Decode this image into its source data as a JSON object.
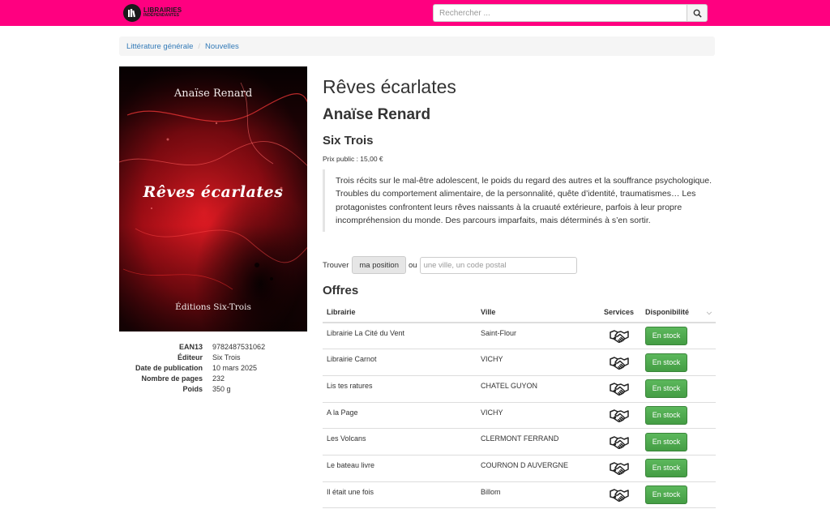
{
  "header": {
    "logo_line1": "LIBRAIRIES",
    "logo_line2": "INDÉPENDANTES",
    "search_placeholder": "Rechercher ...",
    "search_icon": "search-icon"
  },
  "breadcrumb": [
    {
      "label": "Littérature générale"
    },
    {
      "label": "Nouvelles"
    }
  ],
  "cover": {
    "author": "Anaïse Renard",
    "title": "Rêves écarlates",
    "publisher": "Éditions Six-Trois"
  },
  "meta": [
    {
      "label": "EAN13",
      "value": "9782487531062"
    },
    {
      "label": "Éditeur",
      "value": "Six Trois"
    },
    {
      "label": "Date de publication",
      "value": "10 mars 2025"
    },
    {
      "label": "Nombre de pages",
      "value": "232"
    },
    {
      "label": "Poids",
      "value": "350 g"
    }
  ],
  "book": {
    "title": "Rêves écarlates",
    "author": "Anaïse Renard",
    "publisher": "Six Trois",
    "price": "Prix public : 15,00 €",
    "description": "Trois récits sur le mal-être adolescent, le poids du regard des autres et la souffrance psychologique. Troubles du comportement alimentaire, de la personnalité, quête d’identité, traumatismes… Les protagonistes confrontent leurs rêves naissants à la cruauté extérieure, parfois à leur propre incompréhension du monde. Des parcours imparfaits, mais déterminés à s’en sortir."
  },
  "find": {
    "label": "Trouver",
    "button": "ma position",
    "or": "ou",
    "placeholder": "une ville, un code postal"
  },
  "offers": {
    "heading": "Offres",
    "columns": {
      "store": "Librairie",
      "city": "Ville",
      "services": "Services",
      "availability": "Disponibilité"
    },
    "rows": [
      {
        "store": "Librairie La Cité du Vent",
        "city": "Saint-Flour",
        "service_icon": "handshake-icon",
        "availability": "En stock"
      },
      {
        "store": "Librairie Carnot",
        "city": "VICHY",
        "service_icon": "handshake-icon",
        "availability": "En stock"
      },
      {
        "store": "Lis tes ratures",
        "city": "CHATEL GUYON",
        "service_icon": "handshake-icon",
        "availability": "En stock"
      },
      {
        "store": "A la Page",
        "city": "VICHY",
        "service_icon": "handshake-icon",
        "availability": "En stock"
      },
      {
        "store": "Les Volcans",
        "city": "CLERMONT FERRAND",
        "service_icon": "handshake-icon",
        "availability": "En stock"
      },
      {
        "store": "Le bateau livre",
        "city": "COURNON D AUVERGNE",
        "service_icon": "handshake-icon",
        "availability": "En stock"
      },
      {
        "store": "Il était une fois",
        "city": "Billom",
        "service_icon": "handshake-icon",
        "availability": "En stock"
      }
    ]
  },
  "colors": {
    "topbar": "#ff0080",
    "link": "#337ab7",
    "stock_button": "#5cb85c",
    "cover_red": "#c4121c"
  }
}
